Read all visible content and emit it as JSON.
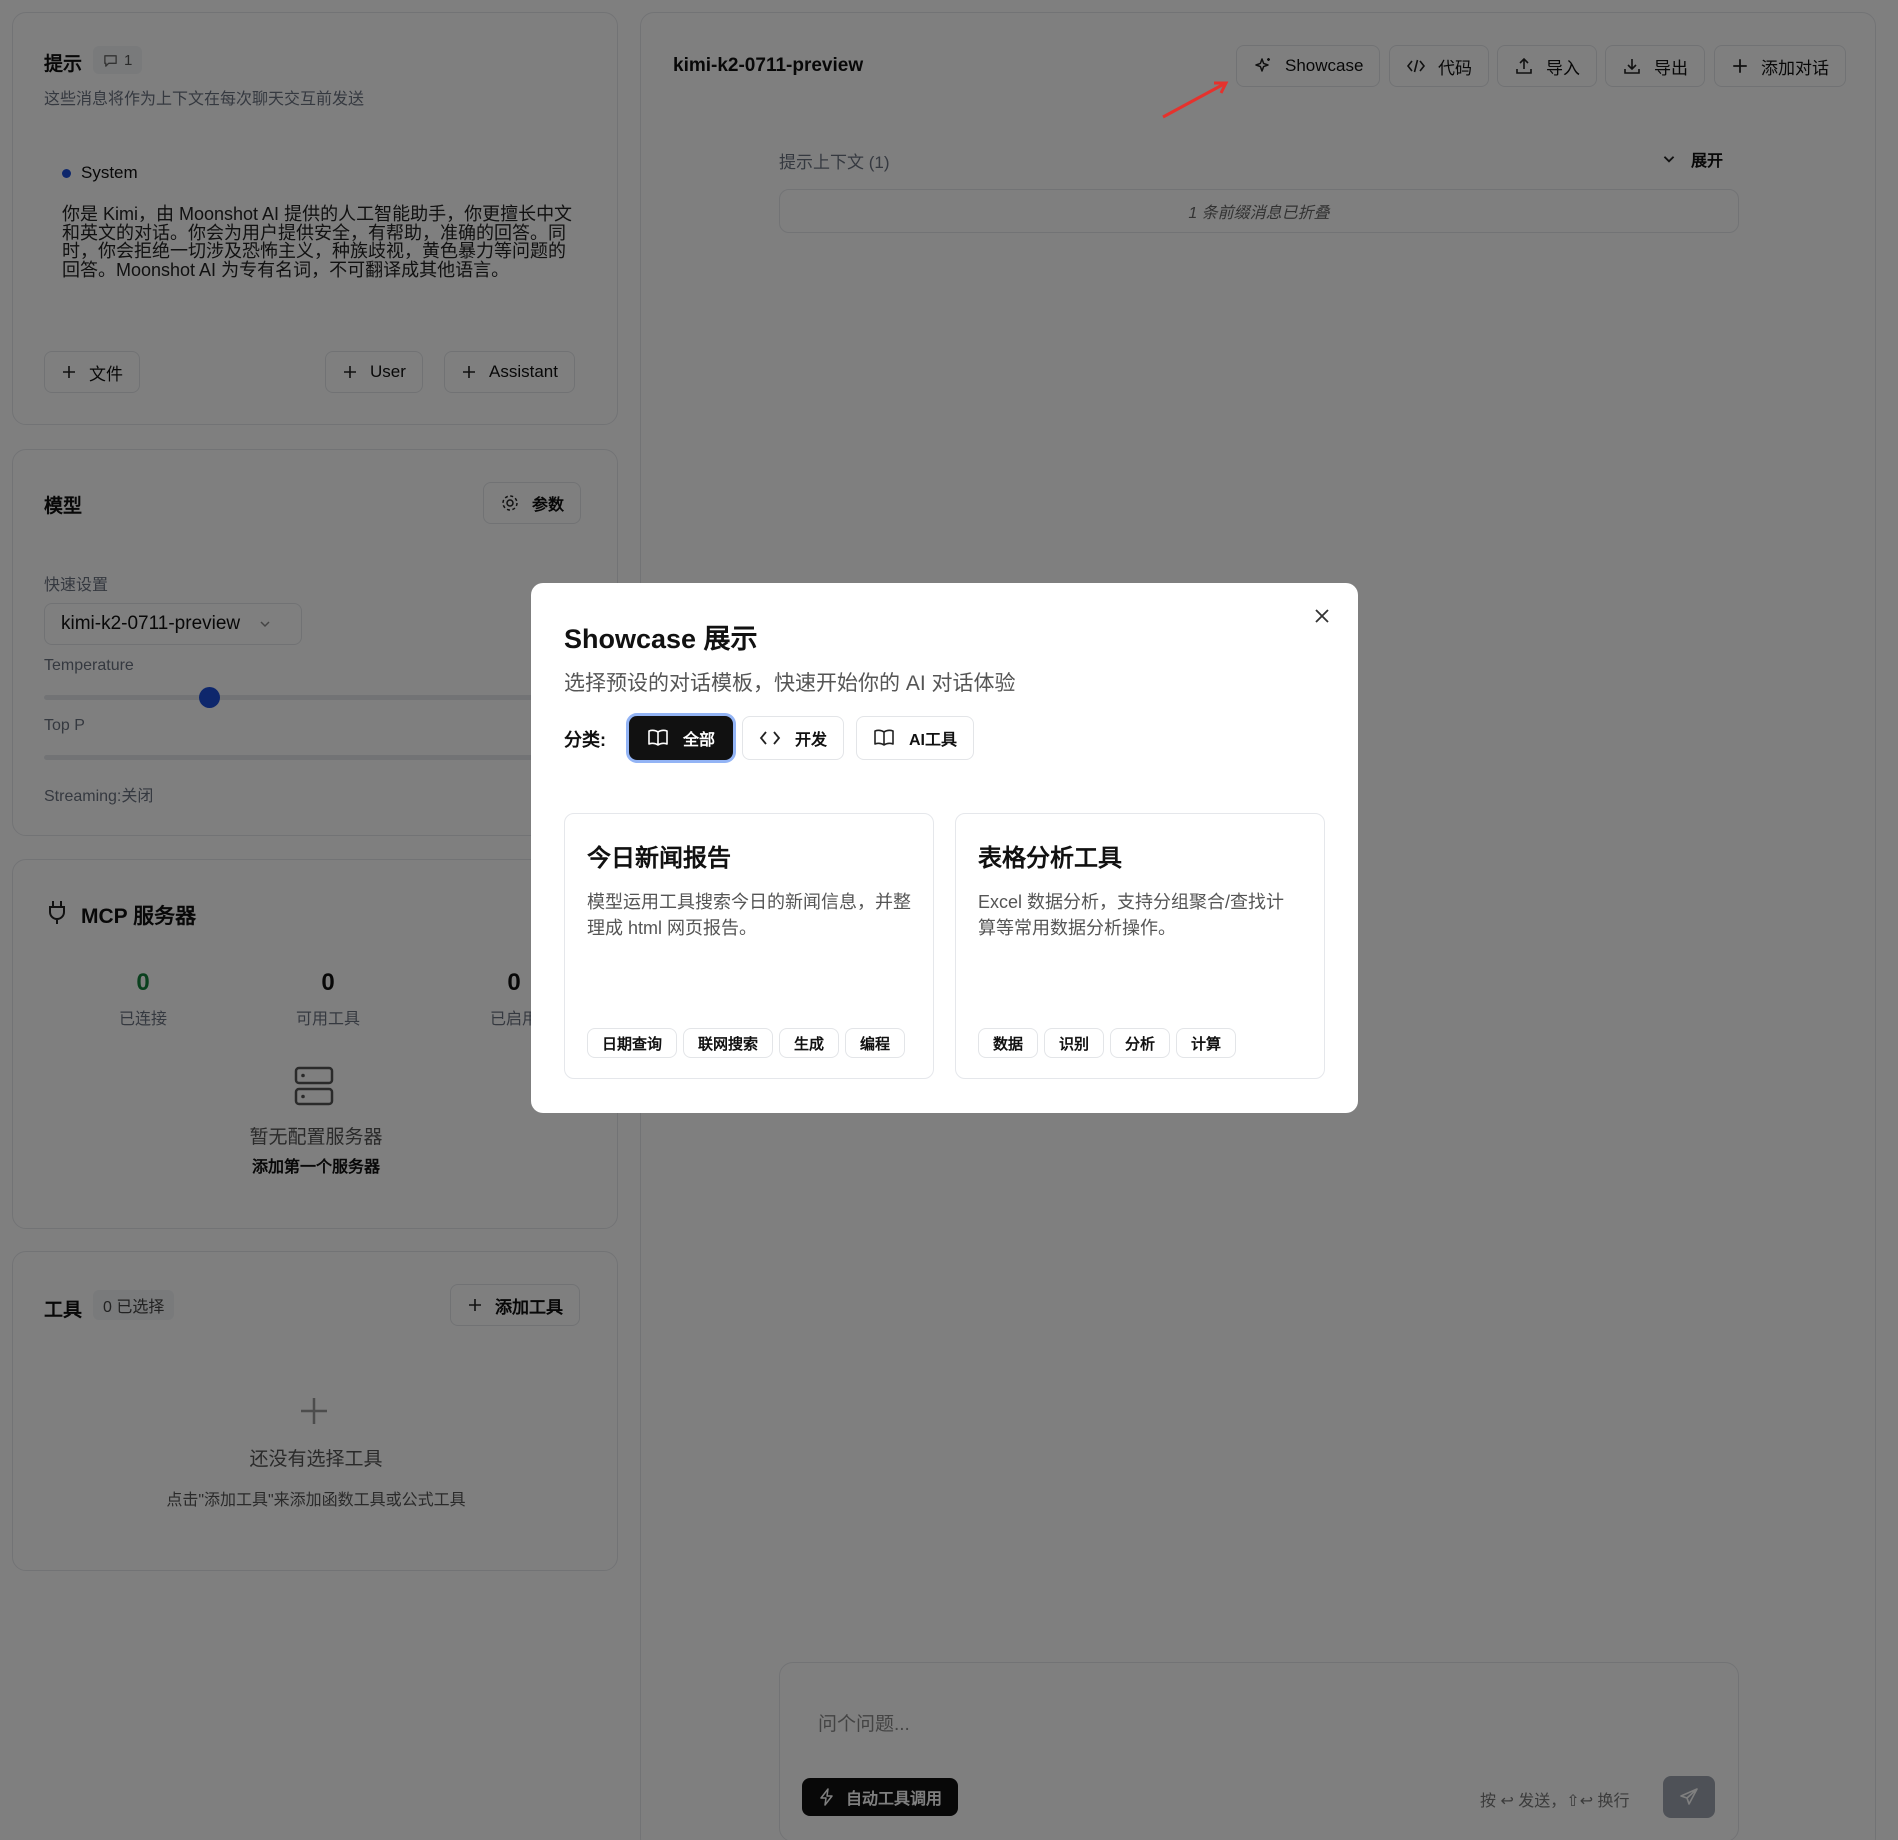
{
  "prompt": {
    "title": "提示",
    "count": "1",
    "subtitle": "这些消息将作为上下文在每次聊天交互前发送",
    "system_role": "System",
    "system_text": "你是 Kimi，由 Moonshot AI 提供的人工智能助手，你更擅长中文和英文的对话。你会为用户提供安全，有帮助，准确的回答。同时，你会拒绝一切涉及恐怖主义，种族歧视，黄色暴力等问题的回答。Moonshot AI 为专有名词，不可翻译成其他语言。",
    "btn_file": "文件",
    "btn_user": "User",
    "btn_assistant": "Assistant"
  },
  "model": {
    "title": "模型",
    "params_btn": "参数",
    "quick_label": "快速设置",
    "model_value": "kimi-k2-0711-preview",
    "temperature_label": "Temperature",
    "temperature_fraction": 0.29,
    "top_p_label": "Top P",
    "streaming": "Streaming:关闭"
  },
  "mcp": {
    "title": "MCP 服务器",
    "stats": [
      {
        "value": "0",
        "label": "已连接"
      },
      {
        "value": "0",
        "label": "可用工具"
      },
      {
        "value": "0",
        "label": "已启用"
      }
    ],
    "empty": "暂无配置服务器",
    "add_first": "添加第一个服务器"
  },
  "tools": {
    "title": "工具",
    "selected": "0 已选择",
    "add_btn": "添加工具",
    "empty_title": "还没有选择工具",
    "empty_hint": "点击\"添加工具\"来添加函数工具或公式工具"
  },
  "chat": {
    "title": "kimi-k2-0711-preview",
    "toolbar": {
      "showcase": "Showcase",
      "code": "代码",
      "import": "导入",
      "export": "导出",
      "add": "添加对话"
    },
    "context_label": "提示上下文 (1)",
    "expand": "展开",
    "collapsed_note": "1 条前缀消息已折叠",
    "input_placeholder": "问个问题...",
    "auto_tool": "自动工具调用",
    "send_hint": "按 ↩ 发送，⇧↩ 换行"
  },
  "modal": {
    "title": "Showcase 展示",
    "subtitle": "选择预设的对话模板，快速开始你的 AI 对话体验",
    "category_label": "分类:",
    "categories": [
      "全部",
      "开发",
      "AI工具"
    ],
    "cards": [
      {
        "title": "今日新闻报告",
        "desc": "模型运用工具搜索今日的新闻信息，并整理成 html 网页报告。",
        "tags": [
          "日期查询",
          "联网搜索",
          "生成",
          "编程"
        ]
      },
      {
        "title": "表格分析工具",
        "desc": "Excel 数据分析，支持分组聚合/查找计算等常用数据分析操作。",
        "tags": [
          "数据",
          "识别",
          "分析",
          "计算"
        ]
      }
    ]
  },
  "colors": {
    "accent_blue": "#1d4ed8",
    "connected_green": "#15803d",
    "annotation_red": "#e5322d"
  }
}
